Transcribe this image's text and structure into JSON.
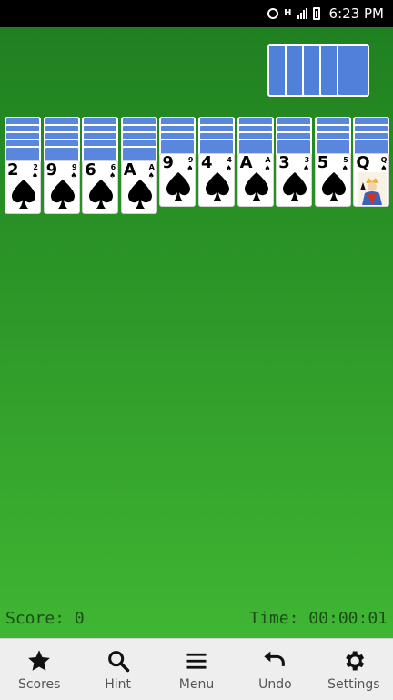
{
  "status_bar": {
    "time": "6:23 PM",
    "network": "H"
  },
  "game": {
    "score_label": "Score: 0",
    "time_label": "Time: 00:00:01",
    "stock_count": 5,
    "columns": [
      {
        "facedown": 5,
        "rank": "2",
        "corner": "2"
      },
      {
        "facedown": 5,
        "rank": "9",
        "corner": "9"
      },
      {
        "facedown": 5,
        "rank": "6",
        "corner": "6"
      },
      {
        "facedown": 5,
        "rank": "A",
        "corner": "A"
      },
      {
        "facedown": 4,
        "rank": "9",
        "corner": "9"
      },
      {
        "facedown": 4,
        "rank": "4",
        "corner": "4"
      },
      {
        "facedown": 4,
        "rank": "A",
        "corner": "A"
      },
      {
        "facedown": 4,
        "rank": "3",
        "corner": "3"
      },
      {
        "facedown": 4,
        "rank": "5",
        "corner": "5"
      },
      {
        "facedown": 4,
        "rank": "Q",
        "corner": "Q"
      }
    ]
  },
  "nav": [
    {
      "label": "Scores",
      "icon": "star-icon"
    },
    {
      "label": "Hint",
      "icon": "search-icon"
    },
    {
      "label": "Menu",
      "icon": "menu-icon"
    },
    {
      "label": "Undo",
      "icon": "undo-icon"
    },
    {
      "label": "Settings",
      "icon": "gear-icon"
    }
  ],
  "colors": {
    "felt_top": "#1f8020",
    "felt_bottom": "#3fb633",
    "card_back": "#5b86dd",
    "hud_text": "#1b4d16"
  }
}
